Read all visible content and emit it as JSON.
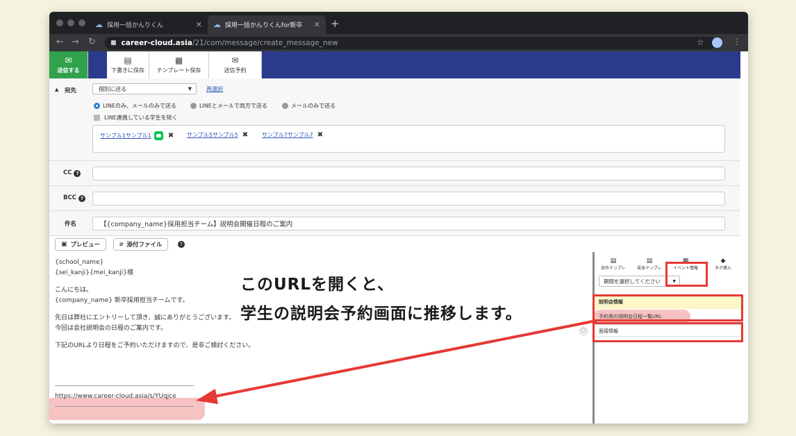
{
  "browser": {
    "tabs": [
      {
        "title": "採用一括かんりくん"
      },
      {
        "title": "採用一括かんりくんfor新卒"
      }
    ],
    "url_domain": "career-cloud.asia",
    "url_path": "/21/com/message/create_message_new"
  },
  "toolbar": {
    "send_label": "送信する",
    "draft_label": "下書きに保存",
    "template_label": "テンプレート保存",
    "schedule_label": "送信予約"
  },
  "form": {
    "recipient_label": "宛先",
    "send_mode": "個別に送る",
    "reselect_label": "再選択",
    "radio_options": [
      "LINEのみ、メールのみで送る",
      "LINEとメールで両方で送る",
      "メールのみで送る"
    ],
    "exclude_line_label": "LINE連携している学生を除く",
    "recipients": [
      "サンプル1サンプル1",
      "サンプル5サンプル5",
      "サンプル7サンプル7"
    ],
    "cc_label": "CC",
    "bcc_label": "BCC",
    "subject_label": "件名",
    "subject_value": "【{company_name}採用担当チーム】説明会開催日程のご案内",
    "preview_label": "プレビュー",
    "attach_label": "添付ファイル"
  },
  "message_body": [
    "{school_name}",
    "{sei_kanji}{mei_kanji}様",
    "",
    "こんにちは。",
    "{company_name} 新卒採用担当チームです。",
    "",
    "先日は弊社にエントリーして頂き、誠にありがとうございます。",
    "今回は会社説明会の日程のご案内です。",
    "",
    "下記のURLより日程をご予約いただけますので、是非ご検討ください。"
  ],
  "message_url": "https://www.career-cloud.asia/s/YUqjce",
  "right_panel": {
    "tabs": [
      "自作テンプレ",
      "見本テンプレ",
      "イベント情報",
      "タグ挿入"
    ],
    "period_select": "期間を選択してください",
    "section_title": "説明会情報",
    "event_item": "予約用の説明会日程一覧URL",
    "interview_item": "面接情報"
  },
  "annotation": {
    "line1": "このURLを開くと、",
    "line2": "学生の説明会予約画面に推移します。"
  },
  "colors": {
    "send_green": "#31a24c",
    "toolbar_navy": "#2b3b8c",
    "highlight_red": "#e53935",
    "section_yellow": "#fdf7c8"
  }
}
